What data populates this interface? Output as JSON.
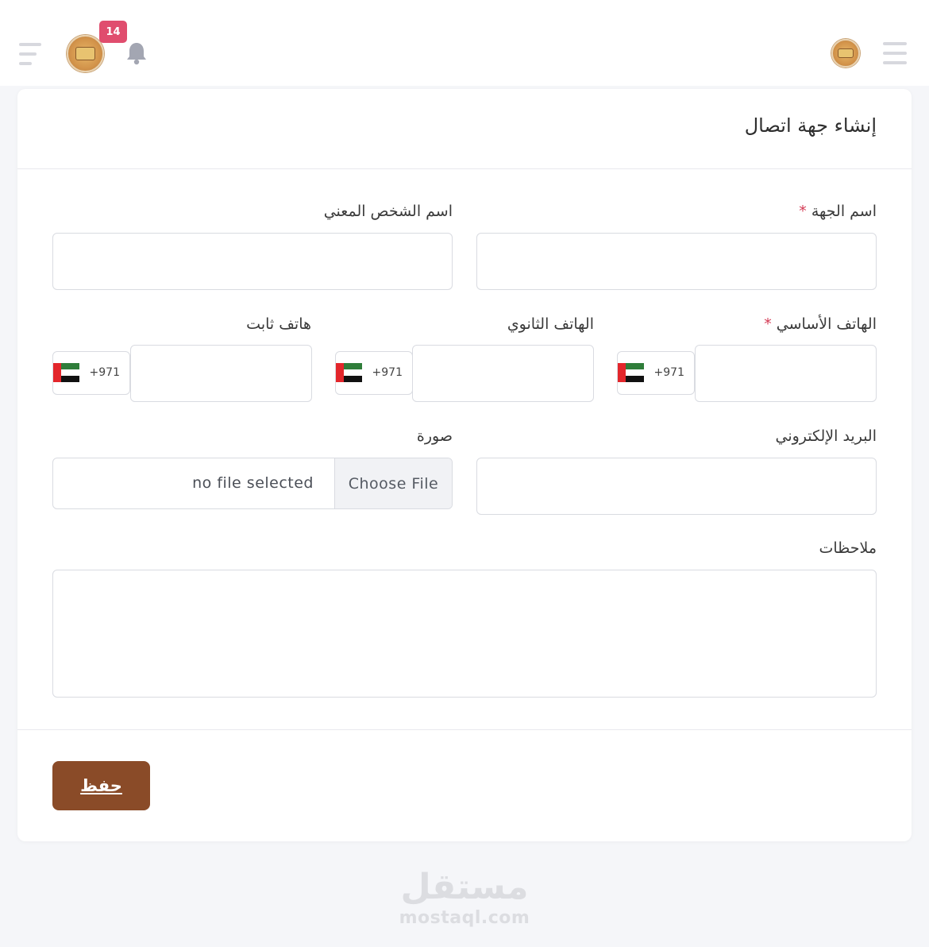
{
  "header": {
    "notification_count": "14",
    "icons": [
      "hamburger-menu-icon",
      "avatar",
      "bell-icon",
      "align-right-menu-icon"
    ]
  },
  "form": {
    "title": "إنشاء جهة اتصال",
    "required_mark": "*",
    "fields": {
      "entity_name": {
        "label": "اسم الجهة",
        "value": ""
      },
      "contact_person": {
        "label": "اسم الشخص المعني",
        "value": ""
      },
      "primary_phone": {
        "label": "الهاتف الأساسي",
        "code": "+971",
        "value": ""
      },
      "secondary_phone": {
        "label": "الهاتف الثانوي",
        "code": "+971",
        "value": ""
      },
      "landline": {
        "label": "هاتف ثابت",
        "code": "+971",
        "value": ""
      },
      "email": {
        "label": "البريد الإلكتروني",
        "value": ""
      },
      "image": {
        "label": "صورة",
        "button": "Choose File",
        "status": "no file selected"
      },
      "notes": {
        "label": "ملاحظات",
        "value": ""
      }
    },
    "save_label": "حفظ"
  },
  "watermark": {
    "logo_text": "مستقل",
    "url": "mostaql.com"
  },
  "colors": {
    "accent": "#8a4b28",
    "badge": "#e04d6e",
    "required": "#d43b55"
  }
}
